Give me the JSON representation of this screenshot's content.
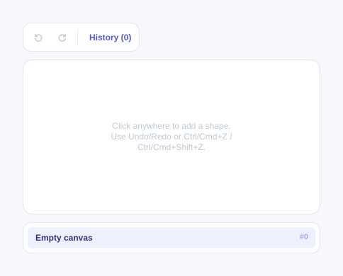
{
  "toolbar": {
    "undo_icon": "undo-icon",
    "redo_icon": "redo-icon",
    "history_label": "History (0)"
  },
  "canvas": {
    "hint": "Click anywhere to add a shape. Use Undo/Redo or Ctrl/Cmd+Z / Ctrl/Cmd+Shift+Z."
  },
  "layers": {
    "items": [
      {
        "label": "Empty canvas",
        "count": "#0"
      }
    ]
  },
  "colors": {
    "accent": "#5457d6",
    "background": "#f7f8fb",
    "icon_disabled": "#c5c9d3",
    "selected_row": "#eef0fd"
  }
}
